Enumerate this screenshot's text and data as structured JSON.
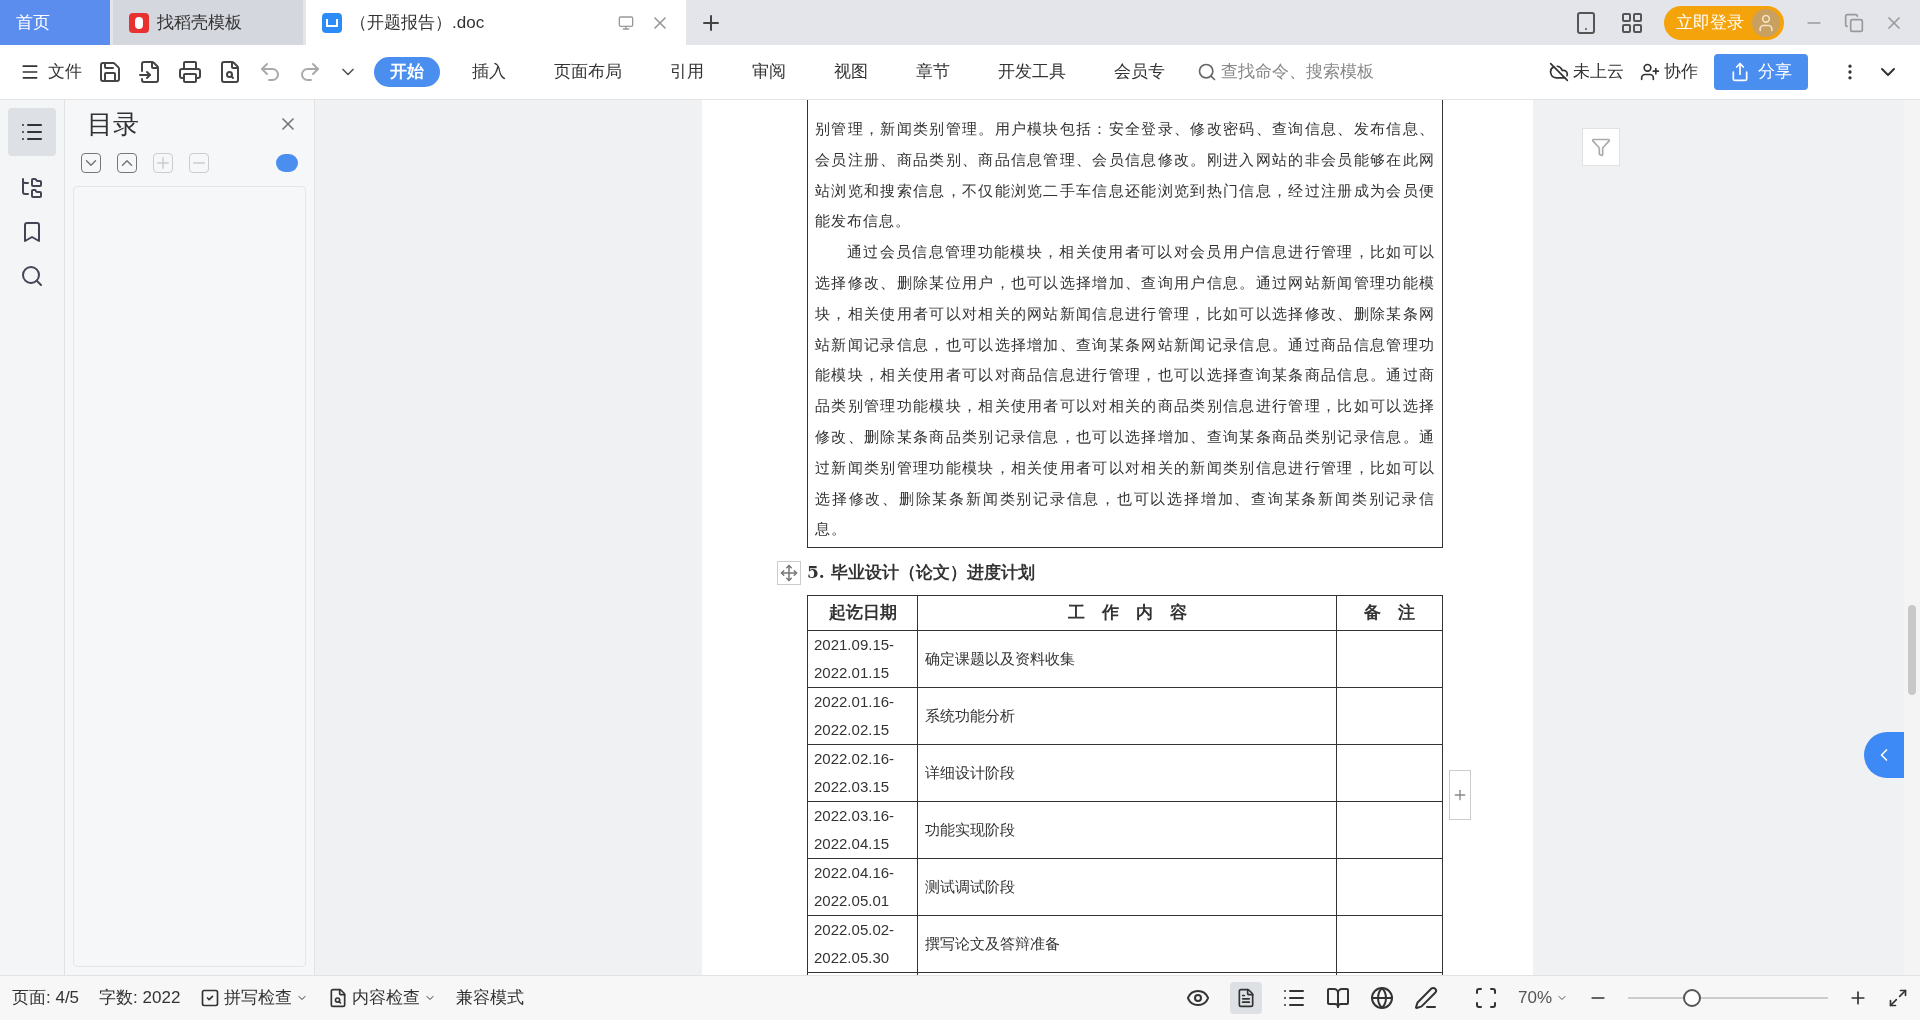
{
  "tabs": [
    {
      "label": "首页",
      "kind": "home",
      "selected": false
    },
    {
      "label": "找稻壳模板",
      "kind": "template",
      "selected": false
    },
    {
      "label": "（开题报告）.doc",
      "kind": "doc",
      "selected": true
    }
  ],
  "login_button": "立即登录",
  "menu": {
    "file": "文件",
    "tabs": [
      {
        "label": "开始",
        "selected": true
      },
      {
        "label": "插入",
        "selected": false
      },
      {
        "label": "页面布局",
        "selected": false
      },
      {
        "label": "引用",
        "selected": false
      },
      {
        "label": "审阅",
        "selected": false
      },
      {
        "label": "视图",
        "selected": false
      },
      {
        "label": "章节",
        "selected": false
      },
      {
        "label": "开发工具",
        "selected": false
      },
      {
        "label": "会员专",
        "selected": false
      }
    ],
    "search": {
      "placeholder": "查找命令、搜索模板"
    },
    "cloud": "未上云",
    "collab": "协作",
    "share": "分享"
  },
  "toc_panel": {
    "title": "目录"
  },
  "document": {
    "paragraphs": [
      {
        "text": "别管理，新闻类别管理。用户模块包括：安全登录、修改密码、查询信息、发布信息、会员注册、商品类别、商品信息管理、会员信息修改。刚进入网站的非会员能够在此网站浏览和搜索信息，不仅能浏览二手车信息还能浏览到热门信息，经过注册成为会员便能发布信息。",
        "indent": false
      },
      {
        "text": "通过会员信息管理功能模块，相关使用者可以对会员用户信息进行管理，比如可以选择修改、删除某位用户，也可以选择增加、查询用户信息。通过网站新闻管理功能模块，相关使用者可以对相关的网站新闻信息进行管理，比如可以选择修改、删除某条网站新闻记录信息，也可以选择增加、查询某条网站新闻记录信息。通过商品信息管理功能模块，相关使用者可以对商品信息进行管理，也可以选择查询某条商品信息。通过商品类别管理功能模块，相关使用者可以对相关的商品类别信息进行管理，比如可以选择修改、删除某条商品类别记录信息，也可以选择增加、查询某条商品类别记录信息。通过新闻类别管理功能模块，相关使用者可以对相关的新闻类别信息进行管理，比如可以选择修改、删除某条新闻类别记录信息，也可以选择增加、查询某条新闻类别记录信息。",
        "indent": true
      }
    ],
    "heading": "5.  毕业设计（论文）进度计划",
    "table": {
      "columns": [
        "起讫日期",
        "工　作　内　容",
        "备　注"
      ],
      "rows": [
        {
          "dates": "2021.09.15-2022.01.15",
          "work": "确定课题以及资料收集"
        },
        {
          "dates": "2022.01.16-2022.02.15",
          "work": "系统功能分析"
        },
        {
          "dates": "2022.02.16-2022.03.15",
          "work": "详细设计阶段"
        },
        {
          "dates": "2022.03.16-2022.04.15",
          "work": "功能实现阶段"
        },
        {
          "dates": "2022.04.16-2022.05.01",
          "work": "测试调试阶段"
        },
        {
          "dates": "2022.05.02-2022.05.30",
          "work": "撰写论文及答辩准备"
        }
      ]
    }
  },
  "status_bar": {
    "page": "页面: 4/5",
    "words": "字数: 2022",
    "spell": "拼写检查",
    "content": "内容检查",
    "compat": "兼容模式",
    "zoom": "70%",
    "zoom_slider": {
      "level": 0.32
    }
  }
}
